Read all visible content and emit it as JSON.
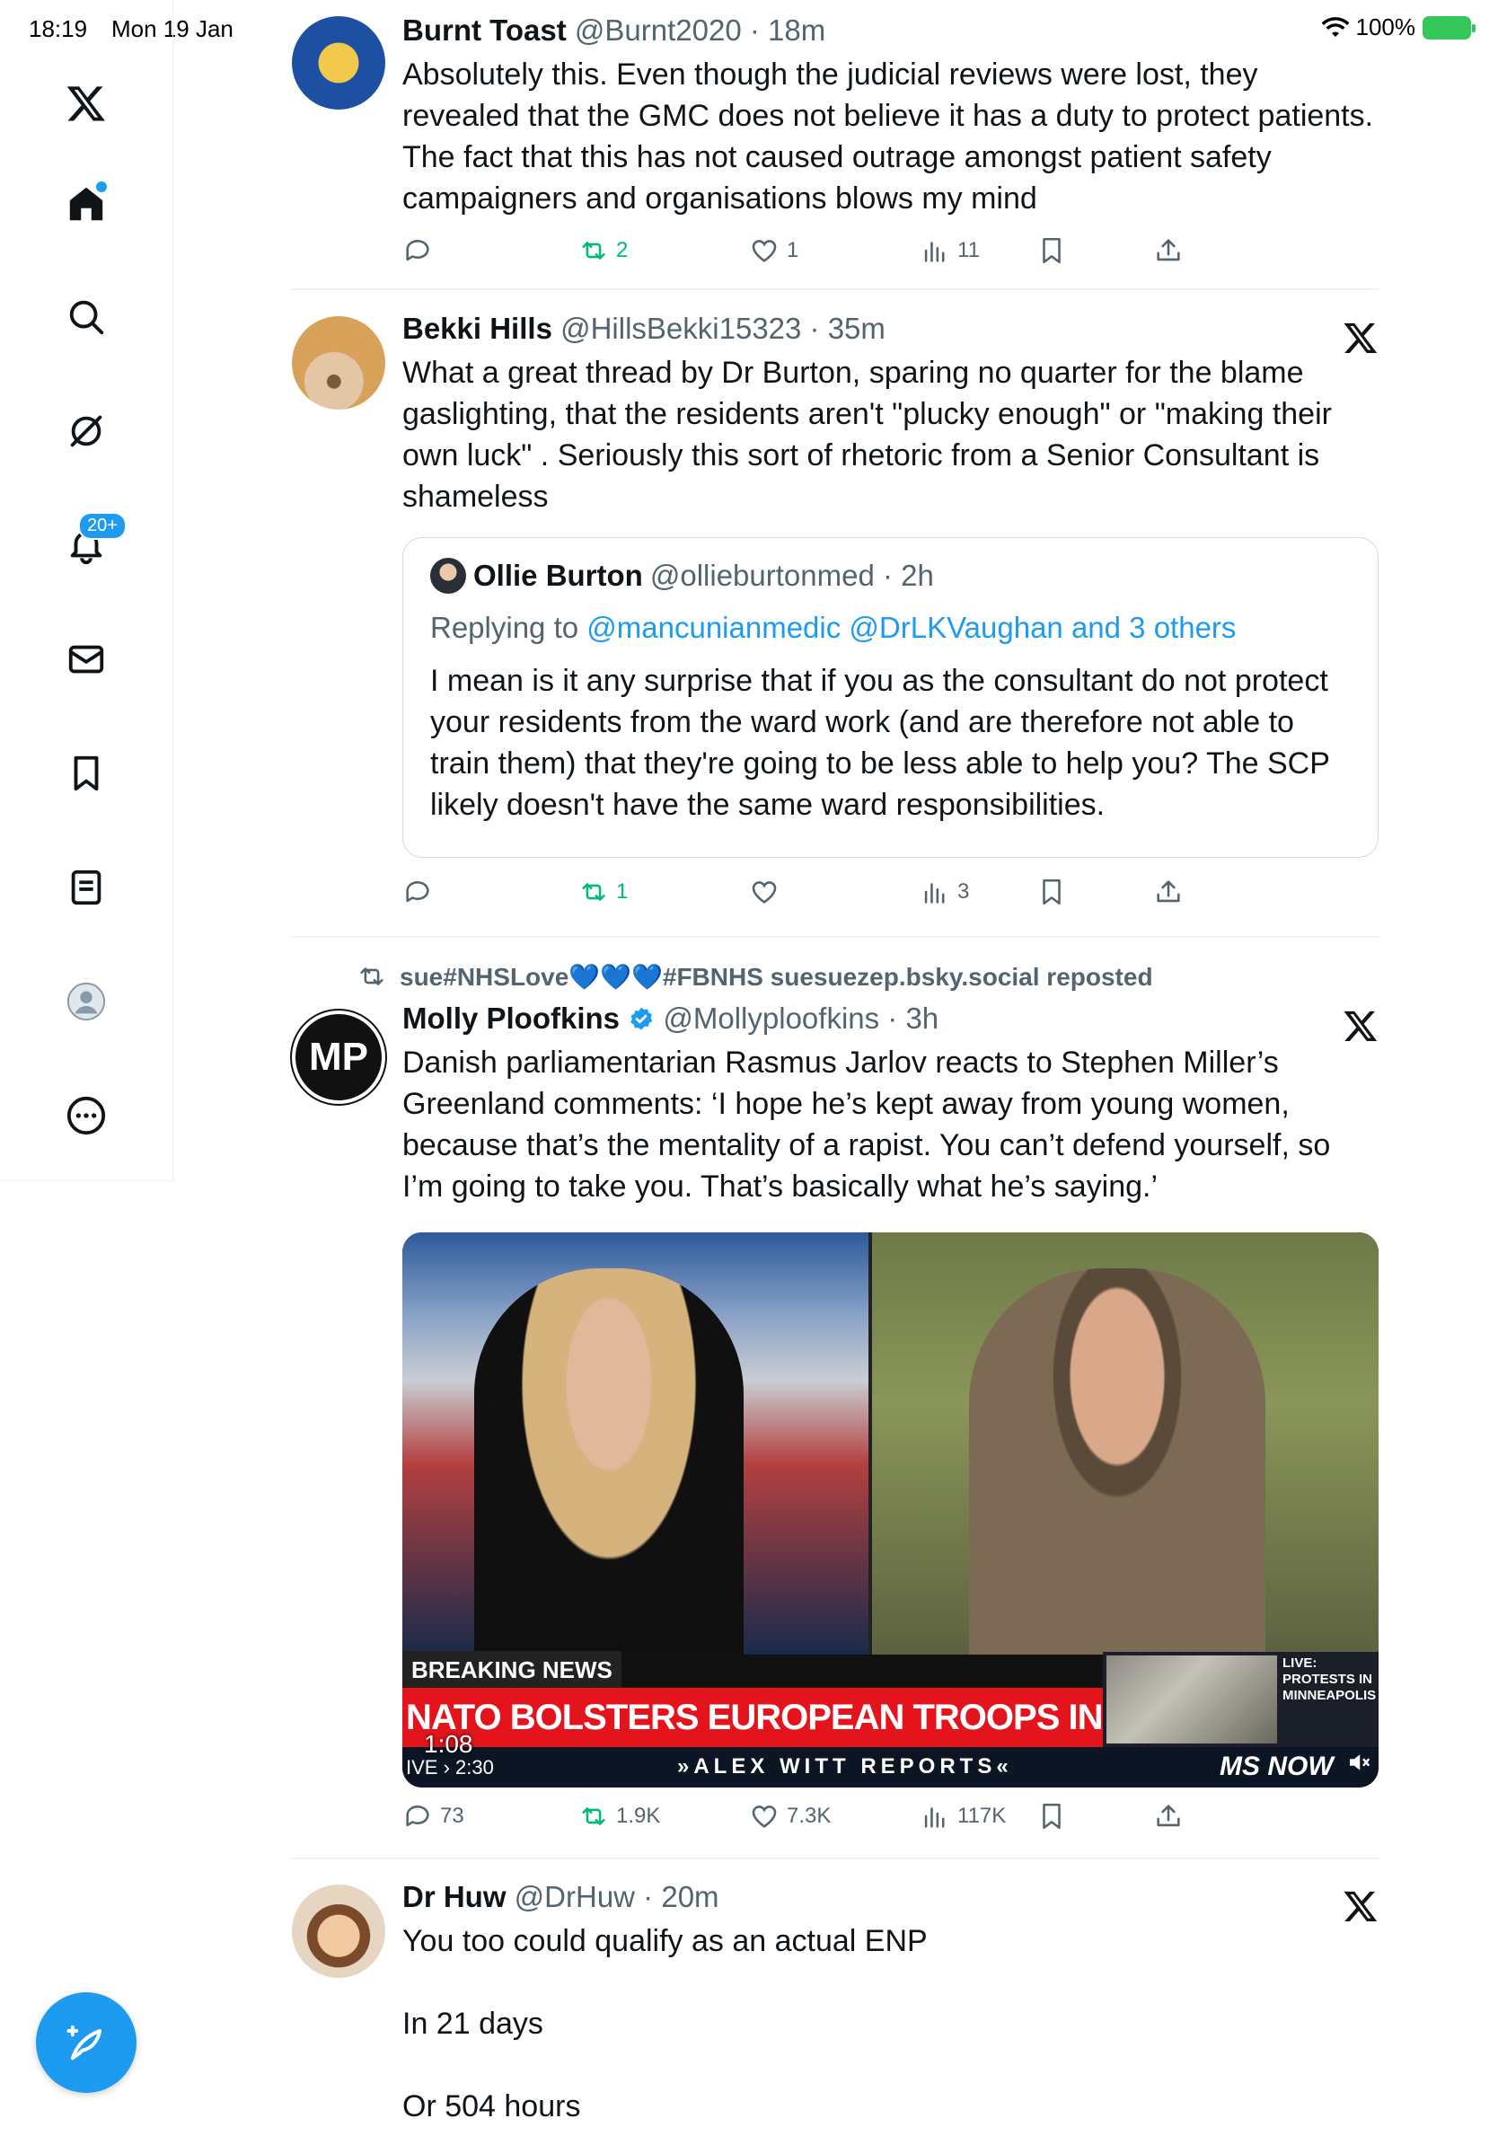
{
  "status_bar": {
    "time": "18:19",
    "date": "Mon 19 Jan",
    "battery": "100%"
  },
  "sidebar": {
    "notifications_badge": "20+"
  },
  "tweets": [
    {
      "name": "Burnt Toast",
      "meta": "@Burnt2020 · 18m",
      "text": "Absolutely this. Even though the judicial reviews were lost, they revealed that the GMC does not believe it has a duty to protect patients. The fact that this has not caused outrage amongst patient safety campaigners and organisations blows my mind",
      "replies": "",
      "reposts": "2",
      "likes": "1",
      "views": "11"
    },
    {
      "name": "Bekki Hills",
      "meta": "@HillsBekki15323 · 35m",
      "text": "What a great thread by Dr Burton, sparing no quarter for the blame gaslighting, that the residents aren't \"plucky enough\" or \"making their own luck\" . Seriously this sort of rhetoric from a Senior Consultant is shameless",
      "quote": {
        "name": "Ollie Burton",
        "meta": "@ollieburtonmed · 2h",
        "replying_label": "Replying to",
        "replying_to": "@mancunianmedic @DrLKVaughan and 3 others",
        "text": "I mean is it any surprise that if you as the consultant do not protect your residents from the ward work (and are therefore not able to train them) that they're going to be less able to help you? The SCP likely doesn't have the same ward responsibilities."
      },
      "replies": "",
      "reposts": "1",
      "likes": "",
      "views": "3"
    },
    {
      "repost_by": "sue#NHSLove💙💙💙#FBNHS suesuezep.bsky.social reposted",
      "name": "Molly Ploofkins",
      "meta": "@Mollyploofkins · 3h",
      "text": "Danish parliamentarian Rasmus Jarlov reacts to Stephen Miller’s Greenland comments: ‘I hope he’s kept away from young women, because that’s the mentality of a rapist. You can’t defend yourself, so I’m going to take you. That’s basically what he’s saying.’",
      "video": {
        "breaking": "BREAKING NEWS",
        "headline": "NATO BOLSTERS EUROPEAN TROOPS IN GREENLAND",
        "duration": "1:08",
        "clock": "IVE › 2:30",
        "show": "»ALEX WITT REPORTS«",
        "live_label": "LIVE:\nPROTESTS IN\nMINNEAPOLIS",
        "brand": "MS NOW"
      },
      "replies": "73",
      "reposts": "1.9K",
      "likes": "7.3K",
      "views": "117K"
    },
    {
      "name": "Dr Huw",
      "meta": "@DrHuw · 20m",
      "text": "You too could qualify as an actual ENP\n\nIn 21 days\n\nOr 504 hours"
    }
  ],
  "colors": {
    "accent": "#1d9bf0",
    "repost_green": "#00ba7c",
    "secondary_text": "#536471"
  }
}
